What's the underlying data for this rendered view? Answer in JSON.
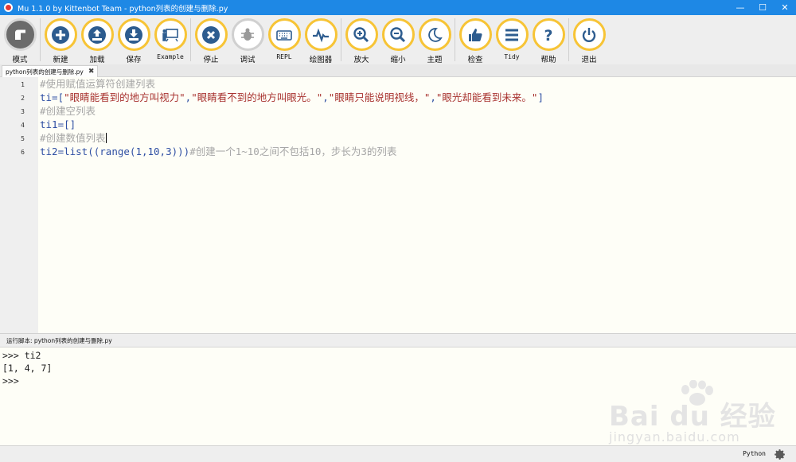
{
  "window": {
    "title": "Mu 1.1.0 by Kittenbot Team - python列表的创建与删除.py",
    "controls": {
      "minimize": "—",
      "maximize": "☐",
      "close": "✕"
    }
  },
  "toolbar": {
    "buttons": [
      {
        "id": "mode",
        "label": "模式",
        "icon": "mode-icon"
      },
      {
        "id": "new",
        "label": "新建",
        "icon": "plus-icon"
      },
      {
        "id": "load",
        "label": "加载",
        "icon": "upload-icon"
      },
      {
        "id": "save",
        "label": "保存",
        "icon": "download-icon"
      },
      {
        "id": "example",
        "label": "Example",
        "icon": "presentation-icon"
      },
      {
        "id": "stop",
        "label": "停止",
        "icon": "close-icon"
      },
      {
        "id": "debug",
        "label": "调试",
        "icon": "bug-icon"
      },
      {
        "id": "repl",
        "label": "REPL",
        "icon": "keyboard-icon"
      },
      {
        "id": "plotter",
        "label": "绘图器",
        "icon": "pulse-icon"
      },
      {
        "id": "zoom_in",
        "label": "放大",
        "icon": "zoom-in-icon"
      },
      {
        "id": "zoom_out",
        "label": "缩小",
        "icon": "zoom-out-icon"
      },
      {
        "id": "theme",
        "label": "主题",
        "icon": "moon-icon"
      },
      {
        "id": "check",
        "label": "检查",
        "icon": "thumbs-up-icon"
      },
      {
        "id": "tidy",
        "label": "Tidy",
        "icon": "lines-icon"
      },
      {
        "id": "help",
        "label": "帮助",
        "icon": "question-icon"
      },
      {
        "id": "quit",
        "label": "退出",
        "icon": "power-icon"
      }
    ]
  },
  "tab": {
    "label": "python列表的创建与删除.py",
    "close": "✖"
  },
  "editor": {
    "line_numbers": [
      "1",
      "2",
      "3",
      "4",
      "5",
      "6"
    ],
    "lines": [
      [
        {
          "t": "#使用赋值运算符创建列表",
          "c": "comment"
        }
      ],
      [
        {
          "t": "ti=[",
          "c": "plain"
        },
        {
          "t": "\"眼睛能看到的地方叫视力\"",
          "c": "str"
        },
        {
          "t": ",",
          "c": "plain"
        },
        {
          "t": "\"眼睛看不到的地方叫眼光。\"",
          "c": "str"
        },
        {
          "t": ",",
          "c": "plain"
        },
        {
          "t": "\"眼睛只能说明视线，\"",
          "c": "str"
        },
        {
          "t": ",",
          "c": "plain"
        },
        {
          "t": "\"眼光却能看到未来。\"",
          "c": "str"
        },
        {
          "t": "]",
          "c": "plain"
        }
      ],
      [
        {
          "t": "#创建空列表",
          "c": "comment"
        }
      ],
      [
        {
          "t": "ti1=[]",
          "c": "plain"
        }
      ],
      [
        {
          "t": "#创建数值列表",
          "c": "comment"
        }
      ],
      [
        {
          "t": "ti2=",
          "c": "plain"
        },
        {
          "t": "list",
          "c": "kw"
        },
        {
          "t": "((",
          "c": "plain"
        },
        {
          "t": "range",
          "c": "kw"
        },
        {
          "t": "(1,10,3)))",
          "c": "plain"
        },
        {
          "t": "#创建一个1~10之间不包括10，步长为3的列表",
          "c": "comment"
        }
      ]
    ]
  },
  "runbar": {
    "text": "运行脚本: python列表的创建与删除.py"
  },
  "repl": {
    "lines": [
      ">>> ti2",
      "[1, 4, 7]",
      ">>>"
    ]
  },
  "watermark": {
    "brand": "Bai du 经验",
    "sub": "jingyan.baidu.com"
  },
  "statusbar": {
    "mode": "Python"
  }
}
